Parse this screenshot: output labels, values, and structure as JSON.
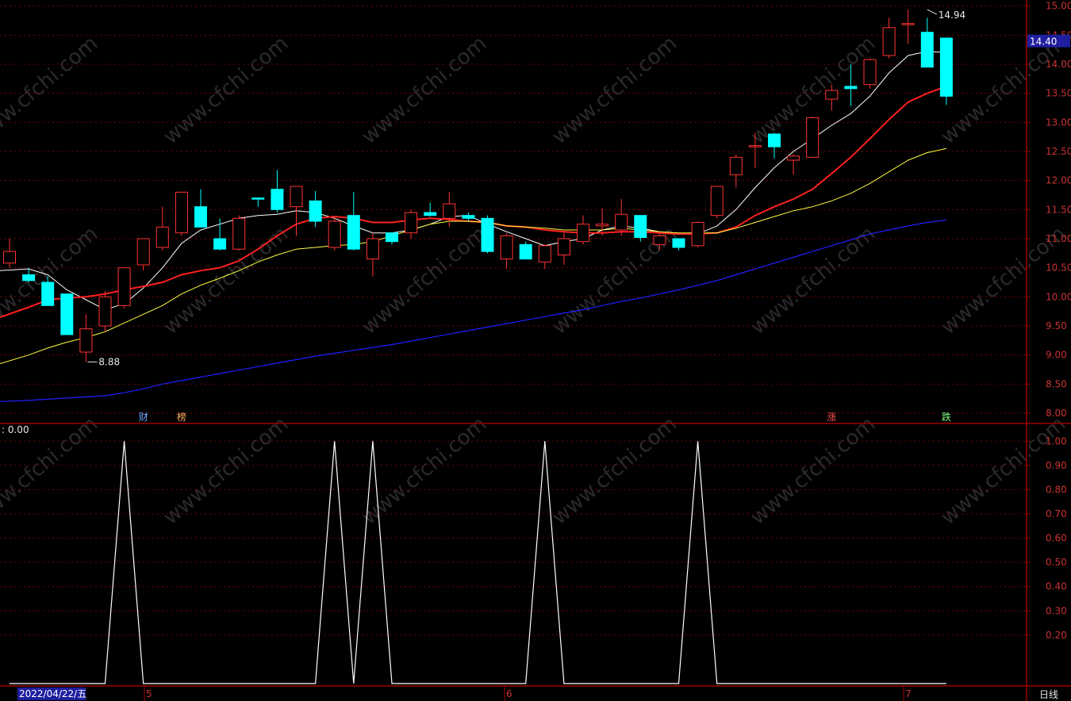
{
  "colors": {
    "background": "#000000",
    "up": "#ff3232",
    "down": "#00ffff",
    "grid": "#7a0000",
    "axis_text": "#c83232",
    "ma5": "#ffffff",
    "ma10": "#ff2020",
    "ma20": "#ffff40",
    "ma60": "#2020ff",
    "indicator": "#ffffff"
  },
  "chart_data": [
    {
      "type": "candlestick",
      "ylim": [
        7.85,
        15.05
      ],
      "y_ticks": [
        "8.00",
        "8.50",
        "9.00",
        "9.50",
        "10.00",
        "10.50",
        "11.00",
        "11.50",
        "12.00",
        "12.50",
        "13.00",
        "13.50",
        "14.00",
        "14.50",
        "15.00"
      ],
      "y_tick_values": [
        8.0,
        8.5,
        9.0,
        9.5,
        10.0,
        10.5,
        11.0,
        11.5,
        12.0,
        12.5,
        13.0,
        13.5,
        14.0,
        14.5,
        15.0
      ],
      "last_price_label": "14.40",
      "last_price": 14.4,
      "high_annotation": {
        "text": "14.94",
        "value": 14.94,
        "index": 48
      },
      "low_annotation": {
        "text": "8.88",
        "value": 8.88,
        "index": 4
      },
      "candles": [
        {
          "o": 10.58,
          "h": 11.0,
          "l": 10.5,
          "c": 10.78
        },
        {
          "o": 10.38,
          "h": 10.5,
          "l": 10.25,
          "c": 10.28
        },
        {
          "o": 10.25,
          "h": 10.35,
          "l": 9.85,
          "c": 9.85
        },
        {
          "o": 10.05,
          "h": 10.05,
          "l": 9.35,
          "c": 9.35
        },
        {
          "o": 9.05,
          "h": 9.7,
          "l": 8.88,
          "c": 9.45
        },
        {
          "o": 9.5,
          "h": 10.1,
          "l": 9.4,
          "c": 10.0
        },
        {
          "o": 9.85,
          "h": 10.5,
          "l": 9.8,
          "c": 10.5
        },
        {
          "o": 10.55,
          "h": 11.0,
          "l": 10.45,
          "c": 11.0
        },
        {
          "o": 10.85,
          "h": 11.55,
          "l": 10.8,
          "c": 11.2
        },
        {
          "o": 11.1,
          "h": 11.8,
          "l": 11.05,
          "c": 11.8
        },
        {
          "o": 11.55,
          "h": 11.85,
          "l": 11.2,
          "c": 11.2
        },
        {
          "o": 11.0,
          "h": 11.35,
          "l": 10.8,
          "c": 10.82
        },
        {
          "o": 10.82,
          "h": 11.4,
          "l": 10.8,
          "c": 11.35
        },
        {
          "o": 11.7,
          "h": 11.7,
          "l": 11.55,
          "c": 11.68
        },
        {
          "o": 11.85,
          "h": 12.18,
          "l": 11.45,
          "c": 11.5
        },
        {
          "o": 11.55,
          "h": 11.9,
          "l": 11.05,
          "c": 11.9
        },
        {
          "o": 11.65,
          "h": 11.82,
          "l": 11.2,
          "c": 11.3
        },
        {
          "o": 10.85,
          "h": 11.38,
          "l": 10.8,
          "c": 11.3
        },
        {
          "o": 11.4,
          "h": 11.8,
          "l": 10.8,
          "c": 10.82
        },
        {
          "o": 10.65,
          "h": 11.1,
          "l": 10.35,
          "c": 11.0
        },
        {
          "o": 11.1,
          "h": 11.1,
          "l": 10.9,
          "c": 10.95
        },
        {
          "o": 11.1,
          "h": 11.5,
          "l": 11.0,
          "c": 11.45
        },
        {
          "o": 11.45,
          "h": 11.62,
          "l": 11.38,
          "c": 11.4
        },
        {
          "o": 11.35,
          "h": 11.8,
          "l": 11.2,
          "c": 11.6
        },
        {
          "o": 11.4,
          "h": 11.45,
          "l": 11.3,
          "c": 11.35
        },
        {
          "o": 11.35,
          "h": 11.4,
          "l": 10.75,
          "c": 10.78
        },
        {
          "o": 10.65,
          "h": 11.1,
          "l": 10.48,
          "c": 11.05
        },
        {
          "o": 10.9,
          "h": 10.95,
          "l": 10.65,
          "c": 10.65
        },
        {
          "o": 10.6,
          "h": 10.9,
          "l": 10.48,
          "c": 10.88
        },
        {
          "o": 10.72,
          "h": 11.1,
          "l": 10.55,
          "c": 11.0
        },
        {
          "o": 10.95,
          "h": 11.4,
          "l": 10.9,
          "c": 11.25
        },
        {
          "o": 11.22,
          "h": 11.52,
          "l": 11.05,
          "c": 11.25
        },
        {
          "o": 11.15,
          "h": 11.68,
          "l": 11.05,
          "c": 11.42
        },
        {
          "o": 11.4,
          "h": 11.4,
          "l": 10.95,
          "c": 11.02
        },
        {
          "o": 10.9,
          "h": 11.12,
          "l": 10.8,
          "c": 11.05
        },
        {
          "o": 11.0,
          "h": 11.0,
          "l": 10.8,
          "c": 10.85
        },
        {
          "o": 10.88,
          "h": 11.3,
          "l": 10.85,
          "c": 11.28
        },
        {
          "o": 11.4,
          "h": 11.9,
          "l": 11.35,
          "c": 11.9
        },
        {
          "o": 12.1,
          "h": 12.45,
          "l": 11.88,
          "c": 12.4
        },
        {
          "o": 12.58,
          "h": 12.82,
          "l": 12.22,
          "c": 12.6
        },
        {
          "o": 12.8,
          "h": 12.82,
          "l": 12.38,
          "c": 12.58
        },
        {
          "o": 12.35,
          "h": 12.45,
          "l": 12.1,
          "c": 12.42
        },
        {
          "o": 12.4,
          "h": 13.1,
          "l": 12.4,
          "c": 13.08
        },
        {
          "o": 13.4,
          "h": 13.65,
          "l": 13.2,
          "c": 13.55
        },
        {
          "o": 13.62,
          "h": 14.0,
          "l": 13.28,
          "c": 13.58
        },
        {
          "o": 13.65,
          "h": 14.1,
          "l": 13.58,
          "c": 14.08
        },
        {
          "o": 14.15,
          "h": 14.8,
          "l": 14.1,
          "c": 14.63
        },
        {
          "o": 14.68,
          "h": 14.94,
          "l": 14.35,
          "c": 14.7
        },
        {
          "o": 14.55,
          "h": 14.8,
          "l": 13.95,
          "c": 13.95
        },
        {
          "o": 14.45,
          "h": 14.45,
          "l": 13.3,
          "c": 13.45
        }
      ],
      "ma_series": [
        {
          "name": "MA5",
          "values": [
            10.45,
            10.48,
            10.38,
            10.12,
            9.95,
            9.78,
            9.88,
            10.15,
            10.5,
            10.92,
            11.15,
            11.25,
            11.35,
            11.4,
            11.42,
            11.48,
            11.45,
            11.35,
            11.22,
            11.1,
            11.1,
            11.15,
            11.25,
            11.38,
            11.4,
            11.25,
            11.12,
            11.0,
            10.88,
            10.95,
            11.0,
            11.15,
            11.22,
            11.18,
            11.12,
            11.08,
            11.08,
            11.22,
            11.5,
            11.88,
            12.22,
            12.5,
            12.72,
            12.95,
            13.15,
            13.45,
            13.85,
            14.15,
            14.22,
            14.2
          ]
        },
        {
          "name": "MA10",
          "values": [
            9.65,
            9.82,
            9.95,
            9.98,
            10.0,
            10.05,
            10.12,
            10.18,
            10.25,
            10.38,
            10.45,
            10.5,
            10.62,
            10.82,
            11.05,
            11.25,
            11.35,
            11.38,
            11.35,
            11.28,
            11.28,
            11.32,
            11.35,
            11.33,
            11.3,
            11.28,
            11.22,
            11.2,
            11.15,
            11.12,
            11.1,
            11.1,
            11.12,
            11.12,
            11.1,
            11.08,
            11.08,
            11.1,
            11.2,
            11.4,
            11.55,
            11.68,
            11.85,
            12.12,
            12.4,
            12.72,
            13.05,
            13.35,
            13.5,
            13.62
          ]
        },
        {
          "name": "MA20",
          "values": [
            8.85,
            9.0,
            9.12,
            9.22,
            9.3,
            9.4,
            9.55,
            9.7,
            9.85,
            10.05,
            10.2,
            10.32,
            10.45,
            10.6,
            10.72,
            10.82,
            10.85,
            10.88,
            10.9,
            10.95,
            11.05,
            11.15,
            11.25,
            11.3,
            11.3,
            11.28,
            11.22,
            11.2,
            11.18,
            11.15,
            11.15,
            11.15,
            11.18,
            11.15,
            11.12,
            11.1,
            11.1,
            11.1,
            11.18,
            11.28,
            11.38,
            11.48,
            11.55,
            11.65,
            11.78,
            11.95,
            12.15,
            12.35,
            12.48,
            12.55
          ]
        },
        {
          "name": "MA60",
          "values": [
            8.2,
            8.22,
            8.24,
            8.26,
            8.28,
            8.3,
            8.35,
            8.42,
            8.5,
            8.56,
            8.62,
            8.68,
            8.74,
            8.8,
            8.86,
            8.92,
            8.98,
            9.03,
            9.08,
            9.13,
            9.18,
            9.24,
            9.3,
            9.36,
            9.42,
            9.48,
            9.54,
            9.6,
            9.66,
            9.72,
            9.78,
            9.85,
            9.92,
            9.98,
            10.05,
            10.12,
            10.2,
            10.28,
            10.38,
            10.48,
            10.58,
            10.68,
            10.78,
            10.88,
            10.98,
            11.08,
            11.15,
            11.22,
            11.28,
            11.32
          ]
        }
      ],
      "markers": [
        {
          "text": "财",
          "index": 7,
          "color": "#6fa8ff"
        },
        {
          "text": "榜",
          "index": 9,
          "color": "#ffb060"
        },
        {
          "text": "涨",
          "index": 43,
          "color": "#ff5050"
        },
        {
          "text": "跌",
          "index": 49,
          "color": "#80ff80"
        }
      ]
    },
    {
      "type": "line",
      "label": ": 0.00",
      "ylim": [
        0,
        1.05
      ],
      "y_ticks": [
        "0.20",
        "0.30",
        "0.40",
        "0.50",
        "0.60",
        "0.70",
        "0.80",
        "0.90",
        "1.00"
      ],
      "y_tick_values": [
        0.2,
        0.3,
        0.4,
        0.5,
        0.6,
        0.7,
        0.8,
        0.9,
        1.0
      ],
      "values": [
        0,
        0,
        0,
        0,
        0,
        0,
        1,
        0,
        0,
        0,
        0,
        0,
        0,
        0,
        0,
        0,
        0,
        1,
        0,
        1,
        0,
        0,
        0,
        0,
        0,
        0,
        0,
        0,
        1,
        0,
        0,
        0,
        0,
        0,
        0,
        0,
        1,
        0,
        0,
        0,
        0,
        0,
        0,
        0,
        0,
        0,
        0,
        0,
        0,
        0
      ]
    }
  ],
  "x_axis": {
    "date_label": "2022/04/22/五",
    "month_labels": [
      {
        "text": "5",
        "index": 7
      },
      {
        "text": "6",
        "index": 26
      },
      {
        "text": "7",
        "index": 47
      }
    ],
    "period_label": "日线"
  },
  "watermark": "www.cfchi.com"
}
